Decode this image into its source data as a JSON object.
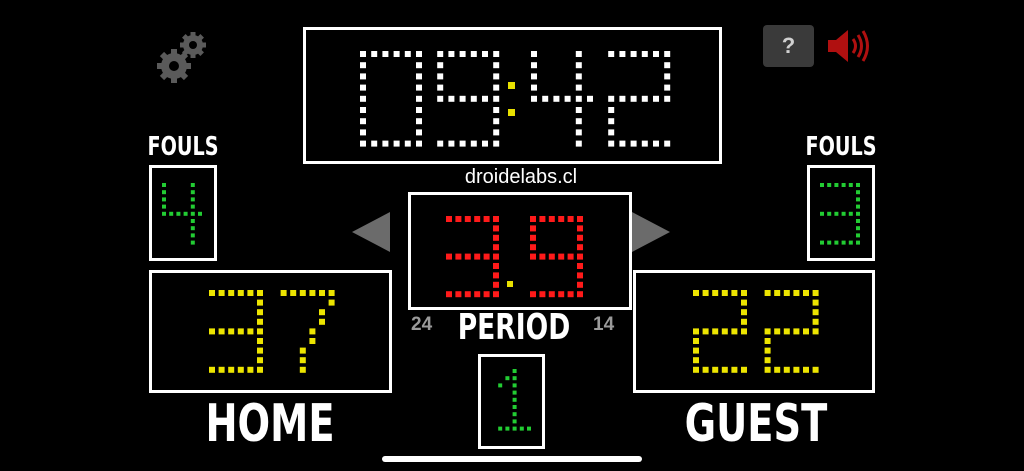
{
  "clock": {
    "minutes": "09",
    "seconds": "42",
    "separator_color": "#e8e000",
    "digit_color": "#ffffff"
  },
  "shot_clock": {
    "value_int": "3",
    "value_dec": "9",
    "digit_color": "#ff1a1a",
    "dot_color": "#e8e000"
  },
  "home": {
    "label": "HOME",
    "score": "37",
    "fouls": "4",
    "fouls_label": "FOULS",
    "timeout_count": "24"
  },
  "guest": {
    "label": "GUEST",
    "score": "22",
    "fouls": "3",
    "fouls_label": "FOULS",
    "timeout_count": "14"
  },
  "period": {
    "label": "PERIOD",
    "value": "1"
  },
  "branding": {
    "site": "droidelabs.cl"
  },
  "toolbar": {
    "help_label": "?"
  },
  "colors": {
    "score": "#ece400",
    "fouls": "#22cc33",
    "period": "#22cc33"
  },
  "icons": {
    "settings": "gears-icon",
    "sound": "speaker-icon",
    "prev": "left-arrow-icon",
    "next": "right-arrow-icon"
  }
}
